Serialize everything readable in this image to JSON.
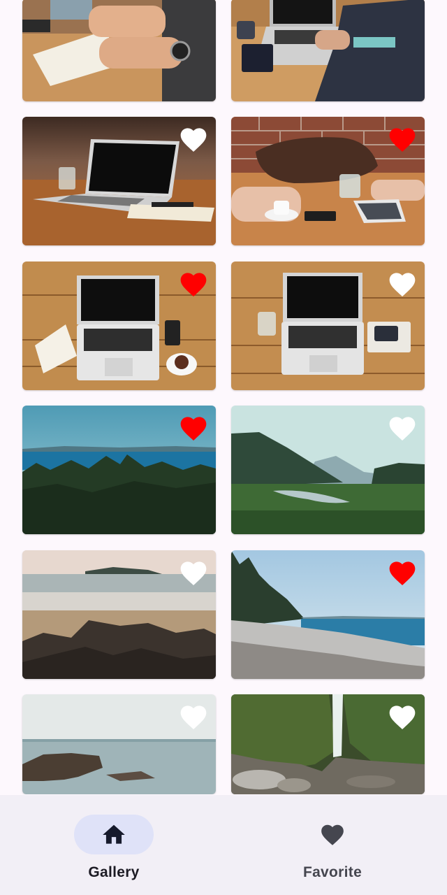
{
  "gallery": {
    "items": [
      {
        "subject": "notebook-writing-photo",
        "favorite": null
      },
      {
        "subject": "laptop-typing-photo",
        "favorite": null
      },
      {
        "subject": "laptop-on-table-photo",
        "favorite": false
      },
      {
        "subject": "meeting-table-photo",
        "favorite": true
      },
      {
        "subject": "laptop-wood-desk-photo",
        "favorite": true
      },
      {
        "subject": "laptop-glass-desk-photo",
        "favorite": false
      },
      {
        "subject": "forest-sea-photo",
        "favorite": true
      },
      {
        "subject": "valley-river-photo",
        "favorite": false
      },
      {
        "subject": "rocky-beach-photo",
        "favorite": false
      },
      {
        "subject": "pebble-shore-photo",
        "favorite": true
      },
      {
        "subject": "calm-sea-rocks-photo",
        "favorite": false
      },
      {
        "subject": "waterfall-canyon-photo",
        "favorite": false
      }
    ]
  },
  "colors": {
    "favorite_on": "#ff0000",
    "favorite_off": "#ffffff",
    "nav_active_pill": "#dfe2f8",
    "nav_background": "#f2eff6"
  },
  "bottom_nav": {
    "items": [
      {
        "label": "Gallery",
        "icon": "home-icon",
        "active": true
      },
      {
        "label": "Favorite",
        "icon": "heart-icon",
        "active": false
      }
    ]
  }
}
